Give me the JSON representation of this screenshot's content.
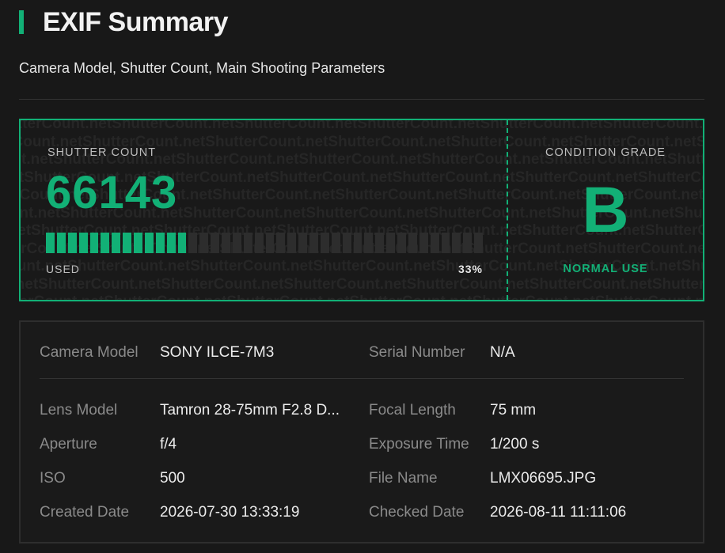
{
  "header": {
    "title": "EXIF Summary",
    "subtitle": "Camera Model, Shutter Count, Main Shooting Parameters"
  },
  "shutter": {
    "label": "SHUTTER COUNT",
    "count": "66143",
    "used_label": "USED",
    "used_percent_text": "33%",
    "used_fraction": 0.33,
    "watermark_text": "ShutterCount.net"
  },
  "grade": {
    "label": "CONDITION GRADE",
    "value": "B",
    "description": "NORMAL USE"
  },
  "details": {
    "rows": [
      [
        {
          "key": "Camera Model",
          "value": "SONY ILCE-7M3"
        },
        {
          "key": "Serial Number",
          "value": "N/A"
        }
      ],
      [
        {
          "key": "Lens Model",
          "value": "Tamron 28-75mm F2.8 D..."
        },
        {
          "key": "Focal Length",
          "value": "75 mm"
        }
      ],
      [
        {
          "key": "Aperture",
          "value": "f/4"
        },
        {
          "key": "Exposure Time",
          "value": "1/200 s"
        }
      ],
      [
        {
          "key": "ISO",
          "value": "500"
        },
        {
          "key": "File Name",
          "value": "LMX06695.JPG"
        }
      ],
      [
        {
          "key": "Created Date",
          "value": "2026-07-30 13:33:19"
        },
        {
          "key": "Checked Date",
          "value": "2026-08-11 11:11:06"
        }
      ]
    ]
  },
  "colors": {
    "accent": "#12b076",
    "background": "#181818"
  }
}
